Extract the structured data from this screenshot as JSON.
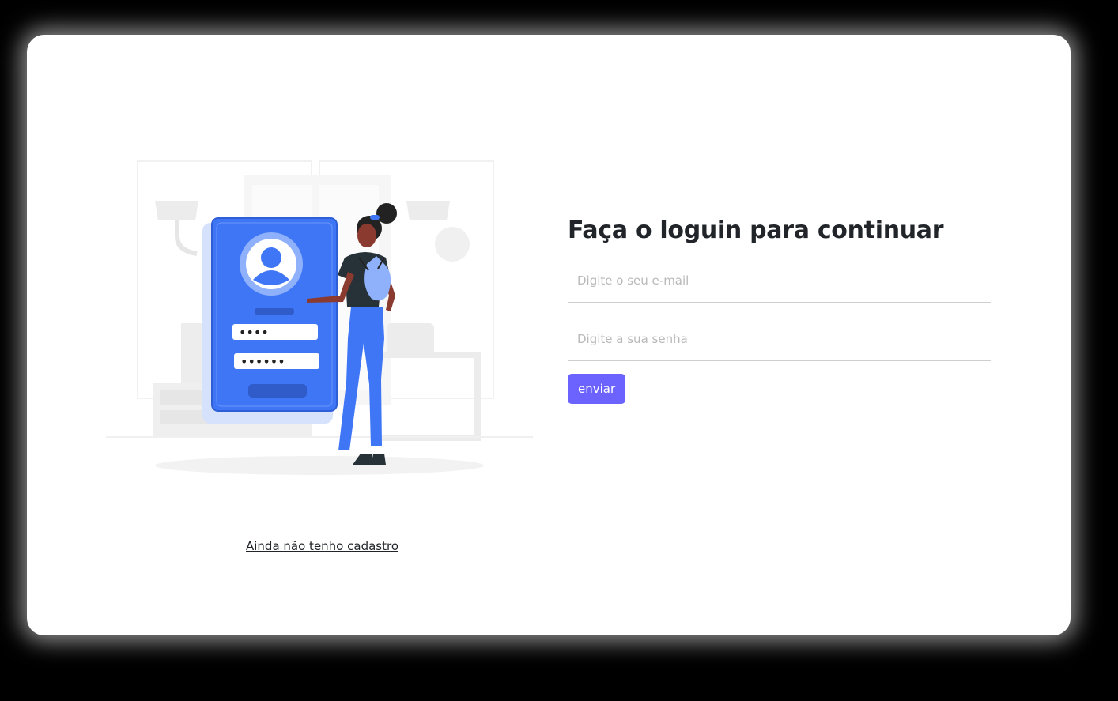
{
  "login": {
    "title": "Faça o loguin para continuar",
    "email_placeholder": "Digite o seu e-mail",
    "email_value": "",
    "password_placeholder": "Digite a sua senha",
    "password_value": "",
    "submit_label": "enviar",
    "register_link": "Ainda não tenho cadastro"
  },
  "illustration": {
    "field_1_mask": "••••",
    "field_2_mask": "••••••"
  },
  "colors": {
    "accent": "#6c63ff",
    "illustration_blue": "#3f76f6",
    "background": "#000000",
    "card": "#ffffff"
  }
}
